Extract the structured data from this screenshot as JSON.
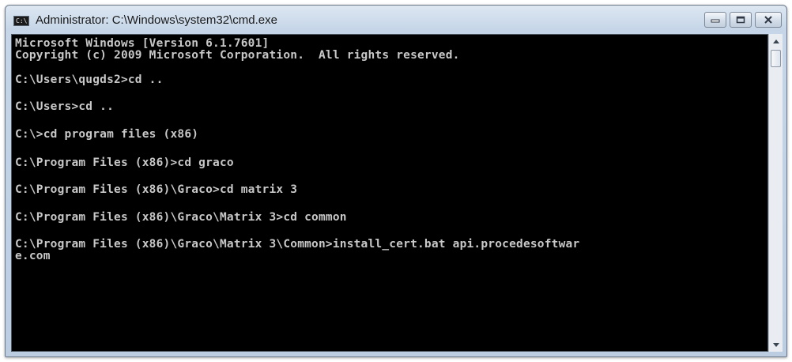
{
  "window": {
    "title": "Administrator: C:\\Windows\\system32\\cmd.exe",
    "icon": "cmd-icon",
    "icon_text": "C:\\"
  },
  "caption_buttons": {
    "minimize": "minimize-icon",
    "maximize": "maximize-icon",
    "close": "close-icon"
  },
  "console": {
    "background": "#000000",
    "foreground": "#c8c8c8",
    "lines": [
      "Microsoft Windows [Version 6.1.7601]",
      "Copyright (c) 2009 Microsoft Corporation.  All rights reserved.",
      "C:\\Users\\qugds2>cd ..",
      "C:\\Users>cd ..",
      "C:\\>cd program files (x86)",
      "C:\\Program Files (x86)>cd graco",
      "C:\\Program Files (x86)\\Graco>cd matrix 3",
      "C:\\Program Files (x86)\\Graco\\Matrix 3>cd common",
      "C:\\Program Files (x86)\\Graco\\Matrix 3\\Common>install_cert.bat api.procedesoftwar",
      "e.com"
    ]
  },
  "scrollbar": {
    "up": "scroll-up-arrow-icon",
    "down": "scroll-down-arrow-icon"
  }
}
